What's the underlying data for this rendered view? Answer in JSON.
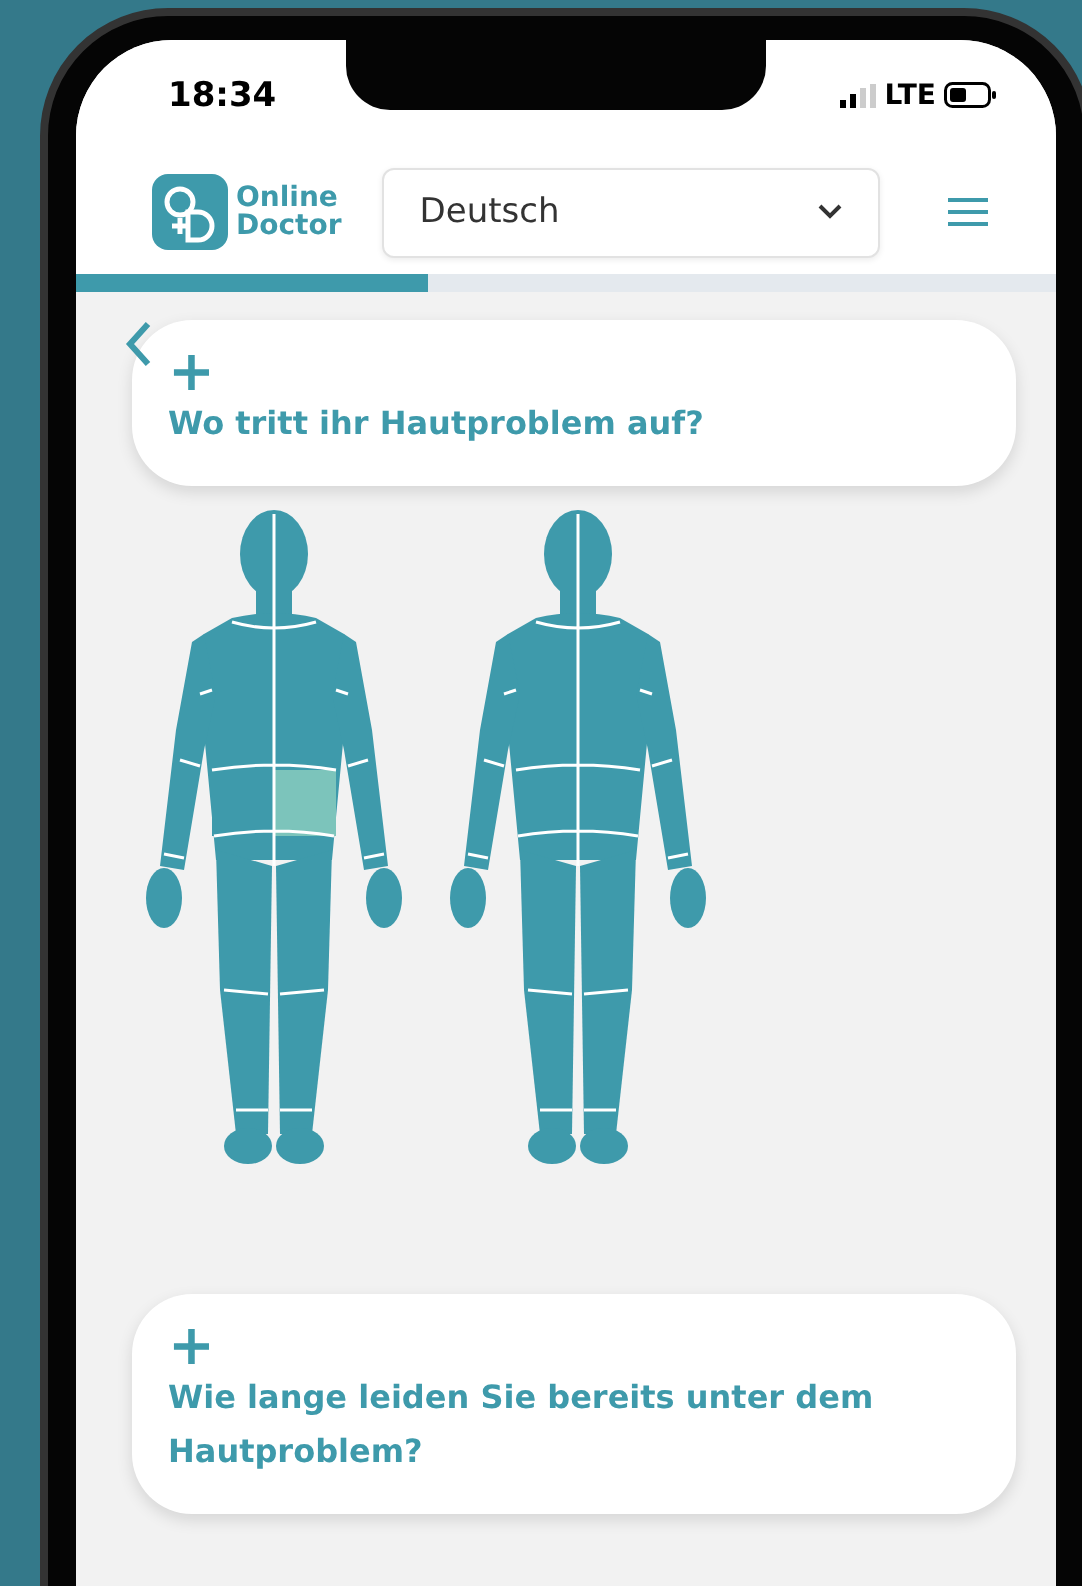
{
  "status_bar": {
    "time": "18:34",
    "network": "LTE"
  },
  "header": {
    "logo": [
      "Online",
      "Doctor"
    ],
    "language_select": {
      "value": "Deutsch"
    }
  },
  "progress": {
    "level": 0.36
  },
  "questions": [
    {
      "icon": "+",
      "title": "Wo tritt ihr Hautproblem auf?"
    },
    {
      "icon": "+",
      "title": "Wie lange leiden Sie bereits unter dem Hautproblem?"
    }
  ],
  "body_map": {
    "front_zones": [
      {
        "selected": false
      },
      {
        "selected": true
      }
    ]
  }
}
